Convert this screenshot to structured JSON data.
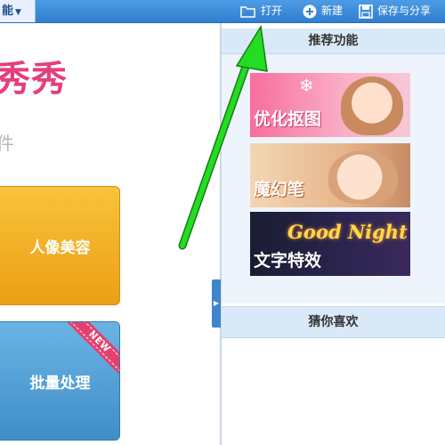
{
  "toolbar": {
    "menu_label": "能",
    "open_label": "打开",
    "new_label": "新建",
    "save_share_label": "保存与分享"
  },
  "main": {
    "brand_title": "秀秀",
    "brand_subtitle": "件",
    "buttons": {
      "beauty_label": "人像美容",
      "batch_label": "批量处理",
      "new_badge": "NEW"
    }
  },
  "sidebar": {
    "recommended_header": "推荐功能",
    "features": [
      {
        "label": "优化抠图"
      },
      {
        "label": "魔幻笔"
      },
      {
        "label": "文字特效",
        "script_text": "Good Night"
      }
    ],
    "guess_header": "猜你喜欢"
  },
  "colors": {
    "toolbar_blue": "#2f7fd0",
    "brand_pink": "#e43f7d",
    "beauty_orange": "#ec9f14",
    "batch_blue": "#3f8ec9",
    "annotation_arrow": "#22dd22"
  }
}
